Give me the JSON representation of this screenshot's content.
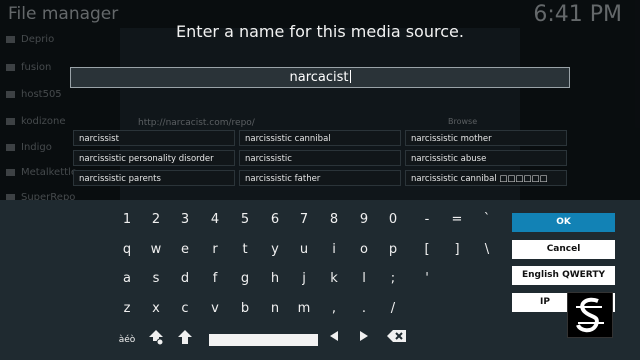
{
  "background": {
    "title": "File manager",
    "clock": "6:41 PM",
    "items": [
      "Deprio",
      "fusion",
      "host505",
      "kodizone",
      "Indigo",
      "Metalkettle",
      "SuperRepo"
    ],
    "url": "http://narcacist.com/repo/",
    "browse_label": "Browse"
  },
  "dialog": {
    "heading": "Enter a name for this media source.",
    "input_value": "narcacist"
  },
  "suggestions": [
    "narcissist",
    "narcissistic cannibal",
    "narcissistic mother",
    "narcissistic personality disorder",
    "narcissistic",
    "narcissistic abuse",
    "narcissistic parents",
    "narcissistic father",
    "narcissistic cannibal □□□□□□"
  ],
  "keyboard": {
    "row1": [
      "1",
      "2",
      "3",
      "4",
      "5",
      "6",
      "7",
      "8",
      "9",
      "0",
      "-",
      "=",
      "`"
    ],
    "row2": [
      "q",
      "w",
      "e",
      "r",
      "t",
      "y",
      "u",
      "i",
      "o",
      "p",
      "[",
      "]",
      "\\"
    ],
    "row3": [
      "a",
      "s",
      "d",
      "f",
      "g",
      "h",
      "j",
      "k",
      "l",
      ";",
      "'"
    ],
    "row4": [
      "z",
      "x",
      "c",
      "v",
      "b",
      "n",
      "m",
      ",",
      ".",
      "/"
    ],
    "special_label": "àéò",
    "buttons": {
      "ok": "OK",
      "cancel": "Cancel",
      "layout": "English QWERTY",
      "ip": "IP"
    }
  },
  "colors": {
    "accent": "#1282b5",
    "keyboard_bg": "#1f2a30"
  },
  "icons": {
    "shift": "shift-up-arrow-icon",
    "caps": "caps-lock-icon",
    "left": "left-arrow-icon",
    "right": "right-arrow-icon",
    "backspace": "backspace-icon"
  }
}
